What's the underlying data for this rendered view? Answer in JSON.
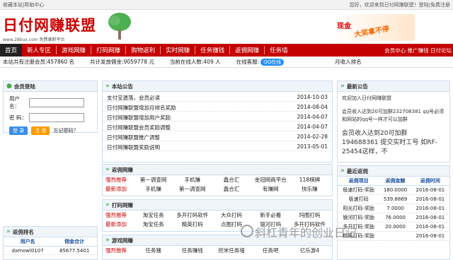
{
  "top": {
    "left": "收藏本站|帮助中心",
    "right": "您好，欢迎来到日付网赚联盟！登陆|免费注册"
  },
  "logo": {
    "title": "日付网赚联盟",
    "sub": "www.28bux.com   免费兼职平台"
  },
  "banner": {
    "a": "现金",
    "b": "大奖拿不停"
  },
  "nav": {
    "items": [
      "首页",
      "新人专区",
      "游戏网赚",
      "打码网赚",
      "购物返利",
      "实时网赚",
      "任务赚钱",
      "返佣网赚",
      "任务墙"
    ],
    "right": "会员中心 推广赚钱 日付论坛"
  },
  "stats": {
    "members": "本站共有注册会员:457860 名",
    "paid": "共计发放佣金:9059778 元",
    "online": "当前在线人数:409 人",
    "service": "在线客服:",
    "qq": "QQ在线",
    "rank": "月收入排名"
  },
  "login": {
    "title": "会员登陆",
    "user": "用户名：",
    "pass": "密  码：",
    "login": "登 录",
    "reg": "注 册",
    "forgot": "忘记密码？"
  },
  "news": {
    "title": "本站公告",
    "items": [
      {
        "t": "支付宝遗落，会员必读",
        "d": "2014-10-03"
      },
      {
        "t": "日付网赚联盟增加月排名奖励",
        "d": "2014-08-04"
      },
      {
        "t": "日付网赚联盟增加用户奖励",
        "d": "2014-04-07"
      },
      {
        "t": "日付网赚联盟会员奖励调整",
        "d": "2014-04-07"
      },
      {
        "t": "日付网赚联盟推广调整",
        "d": "2014-02-28"
      },
      {
        "t": "日付网赚联盟奖励说明",
        "d": "2013-05-01"
      }
    ]
  },
  "rebate": {
    "title": "返佣网赚",
    "rows": [
      {
        "tag": "强烈推荐",
        "c": [
          "第一调查网",
          "手机赚",
          "鑫合汇",
          "金冠网商平台",
          "118棋牌"
        ]
      },
      {
        "tag": "最新添加",
        "c": [
          "手机赚",
          "第一调查网",
          "鑫合汇",
          "有赚网",
          "快乐赚"
        ]
      }
    ]
  },
  "captcha": {
    "title": "打码网赚",
    "rows": [
      {
        "tag": "强烈推荐",
        "c": [
          "淘宝任务",
          "多开打码软件",
          "大众打码",
          "新手必看",
          "玛图打码"
        ]
      },
      {
        "tag": "最新添加",
        "c": [
          "淘宝任务",
          "精英打码",
          "点图打码",
          "银河打码",
          "多开打码软件"
        ]
      }
    ]
  },
  "game": {
    "title": "游戏网赚",
    "rows": [
      {
        "tag": "强烈推荐",
        "c": [
          "任务猪",
          "任务赚钱",
          "挖米任务墙",
          "任务吧",
          "亿乐游4"
        ]
      }
    ]
  },
  "notice": {
    "title": "最新公告",
    "l1": "欢迎加入日付网赚联盟",
    "l2": "会员收入达到20可加群232708381 qq号必须和网站的qq号一样才可以加群",
    "l3": "会员收入达到20可加群 194688361  提交实时工号 如RF-25454这样，不"
  },
  "latest": {
    "title": "最近返佣",
    "headers": [
      "返佣项目",
      "返佣金额",
      "返佣时间"
    ],
    "rows": [
      [
        "极速打码-奖励",
        "180.0000",
        "2016-08-01"
      ],
      [
        "极速打码",
        "539.8869",
        "2016-08-01"
      ],
      [
        "阳光打码-奖励",
        "7.0000",
        "2016-08-01"
      ],
      [
        "银河打码-奖励",
        "76.0000",
        "2016-08-01"
      ],
      [
        "多开打码-奖励",
        "20.0000",
        "2016-08-01"
      ],
      [
        "精英打码-奖励",
        "",
        "2016-08-01"
      ]
    ]
  },
  "ranking": {
    "title": "返佣排名",
    "headers": [
      "用户名",
      "佣金合计"
    ],
    "rows": [
      [
        "damowl0107",
        "85677.5401"
      ]
    ]
  },
  "watermark": "斜杠青年的创业日记"
}
